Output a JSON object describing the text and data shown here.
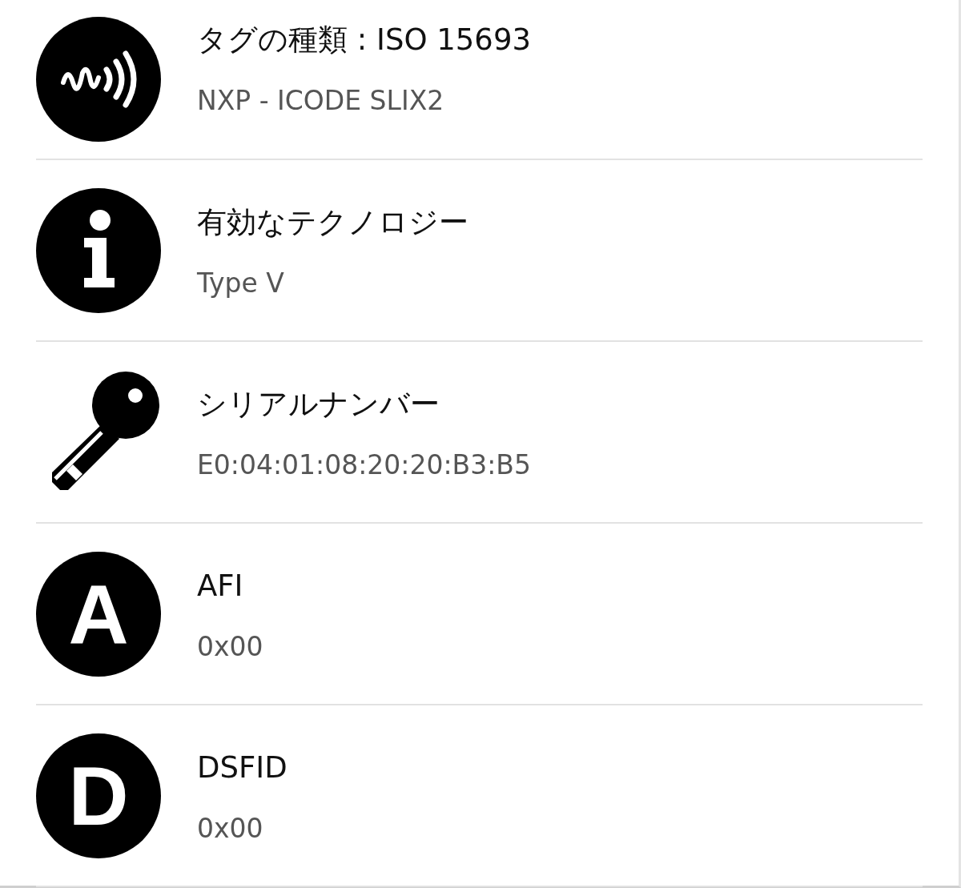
{
  "rows": [
    {
      "icon": {
        "kind": "nfc"
      },
      "title": "タグの種類 : ISO 15693",
      "value": "NXP - ICODE SLIX2"
    },
    {
      "icon": {
        "kind": "info"
      },
      "title": "有効なテクノロジー",
      "value": "Type V"
    },
    {
      "icon": {
        "kind": "key"
      },
      "title": "シリアルナンバー",
      "value": "E0:04:01:08:20:20:B3:B5"
    },
    {
      "icon": {
        "kind": "letter",
        "glyph": "A"
      },
      "title": "AFI",
      "value": "0x00"
    },
    {
      "icon": {
        "kind": "letter",
        "glyph": "D"
      },
      "title": "DSFID",
      "value": "0x00"
    }
  ]
}
